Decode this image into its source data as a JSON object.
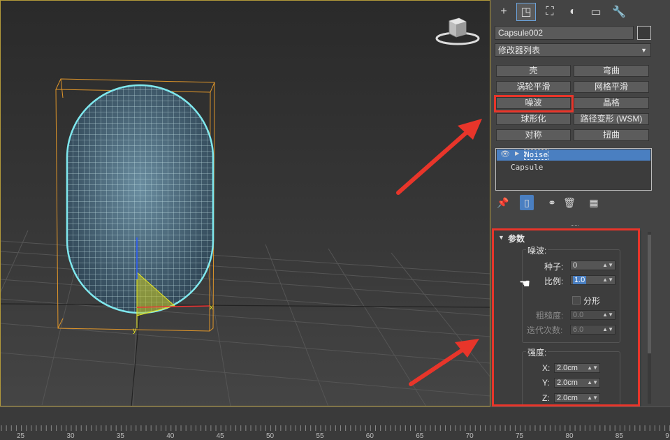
{
  "command_panel": {
    "tabs": [
      {
        "icon": "create-plus-icon",
        "glyph": "+"
      },
      {
        "icon": "modify-icon",
        "glyph": "◳"
      },
      {
        "icon": "hierarchy-icon",
        "glyph": "⛶"
      },
      {
        "icon": "motion-icon",
        "glyph": "◐"
      },
      {
        "icon": "display-icon",
        "glyph": "▭"
      },
      {
        "icon": "utilities-wrench-icon",
        "glyph": "🔧"
      }
    ],
    "object_name": "Capsule002",
    "modifier_list": "修改器列表",
    "modifier_buttons": [
      "壳",
      "弯曲",
      "涡轮平滑",
      "网格平滑",
      "噪波",
      "晶格",
      "球形化",
      "路径变形 (WSM)",
      "对称",
      "扭曲"
    ],
    "stack": [
      {
        "label": "Noise",
        "selected": true
      },
      {
        "label": "Capsule",
        "selected": false
      }
    ]
  },
  "parameters": {
    "rollout_title": "参数",
    "noise_group": "噪波:",
    "seed_label": "种子:",
    "seed_value": "0",
    "scale_label": "比例:",
    "scale_value": "1.0",
    "fractal_label": "分形",
    "roughness_label": "粗糙度:",
    "roughness_value": "0.0",
    "iterations_label": "迭代次数:",
    "iterations_value": "6.0",
    "strength_group": "强度:",
    "x_label": "X:",
    "x_value": "2.0cm",
    "y_label": "Y:",
    "y_value": "2.0cm",
    "z_label": "Z:",
    "z_value": "2.0cm"
  },
  "timeline": {
    "labels": [
      "25",
      "30",
      "35",
      "40",
      "45",
      "50",
      "55",
      "60",
      "65",
      "70",
      "75",
      "80",
      "85",
      "9"
    ]
  },
  "gizmo_labels": {
    "x": "x",
    "y": "y"
  },
  "colors": {
    "highlight_red": "#e8352a",
    "wire": "#7fe8ee",
    "bbox": "#e0962a",
    "selection_blue": "#4a7fc1"
  }
}
